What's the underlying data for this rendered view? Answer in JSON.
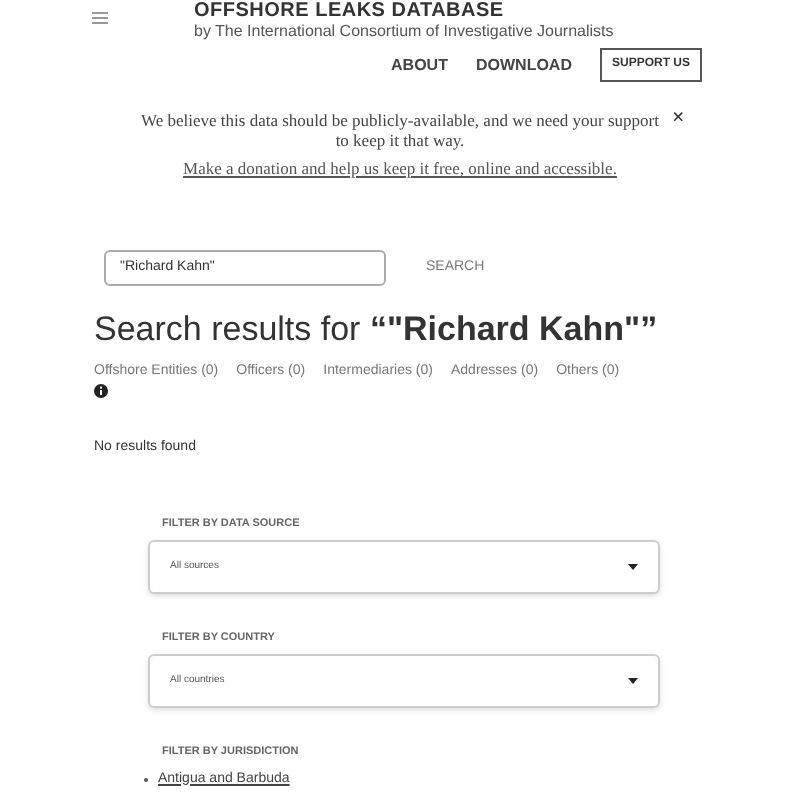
{
  "header": {
    "title": "OFFSHORE LEAKS DATABASE",
    "subtitle": "by The International Consortium of Investigative Journalists"
  },
  "nav": {
    "links": [
      "ABOUT",
      "DOWNLOAD"
    ],
    "button": "SUPPORT US"
  },
  "banner": {
    "message": "We believe this data should be publicly-available, and we need your support to keep it that way.",
    "link": "Make a donation and help us keep it free, online and accessible.",
    "close": "×"
  },
  "search": {
    "value": "\"Richard Kahn\"",
    "button": "SEARCH"
  },
  "results": {
    "heading_prefix": "Search results for ",
    "heading_query": "“\"Richard Kahn\"”",
    "tabs": [
      "Offshore Entities (0)",
      "Officers (0)",
      "Intermediaries (0)",
      "Addresses (0)",
      "Others (0)"
    ],
    "empty": "No results found"
  },
  "filters": [
    {
      "kind": "select",
      "label": "FILTER BY DATA SOURCE",
      "value": "All sources"
    },
    {
      "kind": "select",
      "label": "FILTER BY COUNTRY",
      "value": "All countries"
    },
    {
      "kind": "list",
      "label": "FILTER BY JURISDICTION",
      "items": [
        "Antigua and Barbuda"
      ]
    }
  ]
}
